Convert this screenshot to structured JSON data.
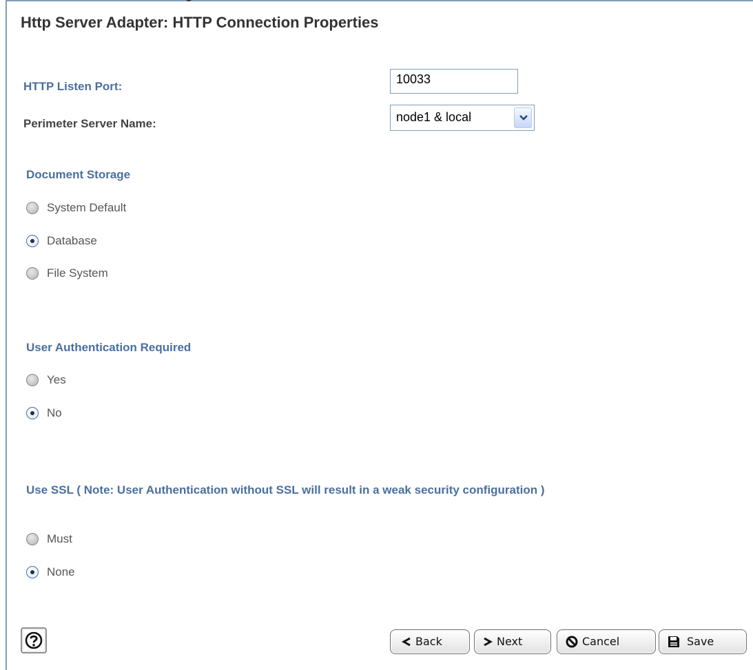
{
  "title": "Http Server Adapter: HTTP Connection Properties",
  "http_port": {
    "label": "HTTP Listen Port:",
    "value": "10033"
  },
  "perimeter": {
    "label": "Perimeter Server Name:",
    "selected": "node1 & local"
  },
  "document_storage": {
    "heading": "Document Storage",
    "options": [
      {
        "label": "System Default",
        "checked": false
      },
      {
        "label": "Database",
        "checked": true
      },
      {
        "label": "File System",
        "checked": false
      }
    ]
  },
  "user_auth": {
    "heading": "User Authentication Required",
    "options": [
      {
        "label": "Yes",
        "checked": false
      },
      {
        "label": "No",
        "checked": true
      }
    ]
  },
  "ssl": {
    "heading": "Use SSL ( Note: User Authentication without SSL will result in a weak security configuration )",
    "options": [
      {
        "label": "Must",
        "checked": false
      },
      {
        "label": "None",
        "checked": true
      }
    ]
  },
  "buttons": {
    "back": "Back",
    "next": "Next",
    "cancel": "Cancel",
    "save": "Save"
  },
  "colors": {
    "label_blue": "#4a6f9e",
    "border": "#7f9db9"
  }
}
